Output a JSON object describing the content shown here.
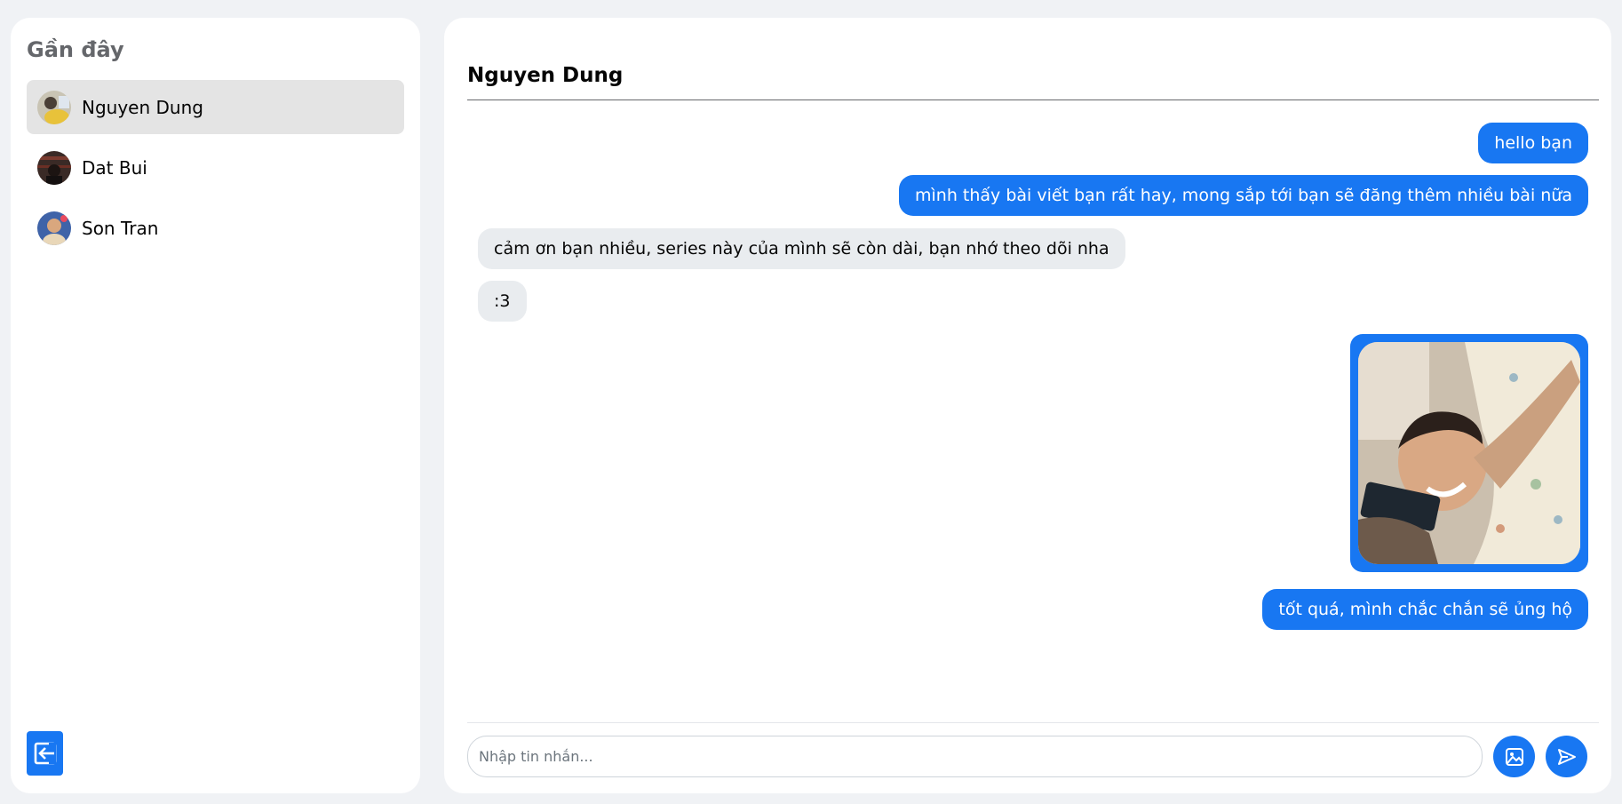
{
  "sidebar": {
    "title": "Gần đây",
    "contacts": [
      {
        "name": "Nguyen Dung",
        "active": true
      },
      {
        "name": "Dat Bui",
        "active": false
      },
      {
        "name": "Son Tran",
        "active": false
      }
    ],
    "logout_icon": "logout-icon"
  },
  "chat": {
    "title": "Nguyen Dung",
    "messages": [
      {
        "direction": "out",
        "text": "hello bạn"
      },
      {
        "direction": "out",
        "text": "mình thấy bài viết bạn rất hay, mong sắp tới bạn sẽ đăng thêm nhiều bài nữa"
      },
      {
        "direction": "in",
        "text": "cảm ơn bạn nhiều, series này của mình sẽ còn dài, bạn nhớ theo dõi nha"
      },
      {
        "direction": "in",
        "text": ":3"
      },
      {
        "direction": "out",
        "type": "image"
      },
      {
        "direction": "out",
        "text": "tốt quá, mình chắc chắn sẽ ủng hộ"
      }
    ]
  },
  "composer": {
    "placeholder": "Nhập tin nhắn...",
    "value": "",
    "image_icon": "image-icon",
    "send_icon": "send-icon"
  },
  "colors": {
    "accent": "#1877f2",
    "background": "#f0f2f5",
    "incoming_bubble": "#e9ecef",
    "active_contact": "#e4e4e4"
  }
}
